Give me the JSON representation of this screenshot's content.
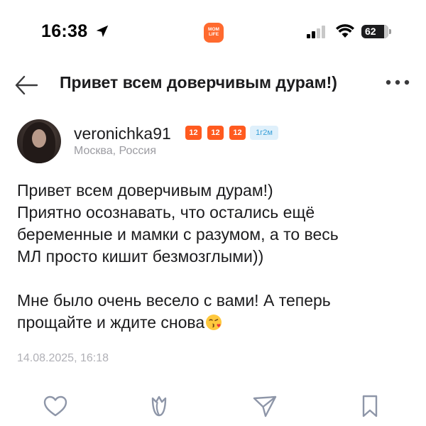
{
  "status_bar": {
    "time": "16:38",
    "app_badge_line1": "MOM",
    "app_badge_line2": "LIFE",
    "battery": "62"
  },
  "header": {
    "title": "Привет всем доверчивым дурам!)"
  },
  "author": {
    "username": "veronichka91",
    "badges": [
      "12",
      "12",
      "12"
    ],
    "account_age": "1г2м",
    "location": "Москва, Россия"
  },
  "post": {
    "lines_p1": [
      "Привет всем доверчивым дурам!)",
      "Приятно осознавать, что остались ещё",
      "беременные и мамки с разумом, а то весь",
      "МЛ просто кишит безмозглыми))"
    ],
    "line_p2_1": "Мне было очень весело с вами! А теперь",
    "line_p2_2": "прощайте и ждите снова",
    "timestamp": "14.08.2025, 16:18"
  },
  "colors": {
    "accent": "#ff5a1f",
    "muted": "#9b9ba1",
    "icon": "#8e96a8"
  }
}
